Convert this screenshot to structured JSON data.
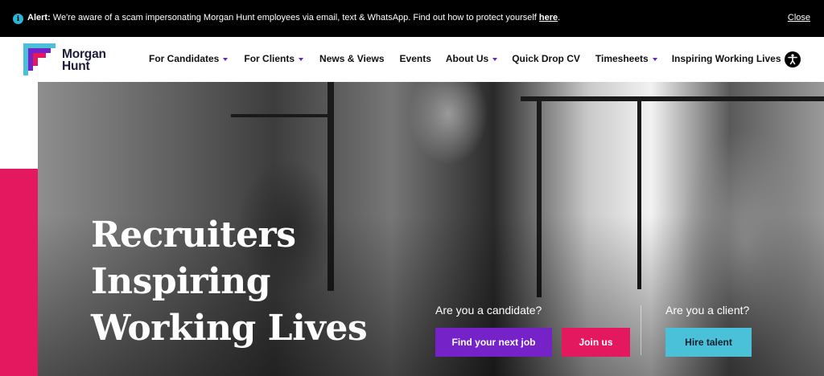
{
  "alert": {
    "icon": "info-icon",
    "label": "Alert:",
    "message": " We're aware of a scam impersonating Morgan Hunt employees via email, text & WhatsApp. Find out how to protect yourself ",
    "link": "here",
    "period": ".",
    "close": "Close"
  },
  "brand": {
    "name_line1": "Morgan",
    "name_line2": "Hunt",
    "colors": {
      "purple": "#7622c9",
      "pink": "#e3185f",
      "blue": "#4bc0d9"
    }
  },
  "nav": {
    "items": [
      {
        "label": "For Candidates",
        "dropdown": true
      },
      {
        "label": "For Clients",
        "dropdown": true
      },
      {
        "label": "News & Views",
        "dropdown": false
      },
      {
        "label": "Events",
        "dropdown": false
      },
      {
        "label": "About Us",
        "dropdown": true
      },
      {
        "label": "Quick Drop CV",
        "dropdown": false
      },
      {
        "label": "Timesheets",
        "dropdown": true
      },
      {
        "label": "Inspiring Working Lives",
        "dropdown": false
      }
    ],
    "accessibility_icon": "accessibility-icon"
  },
  "hero": {
    "title_lines": [
      "Recruiters",
      "Inspiring",
      "Working Lives"
    ],
    "candidate": {
      "question": "Are you a candidate?",
      "primary": "Find your next job",
      "secondary": "Join us"
    },
    "client": {
      "question": "Are you a client?",
      "primary": "Hire talent"
    }
  }
}
